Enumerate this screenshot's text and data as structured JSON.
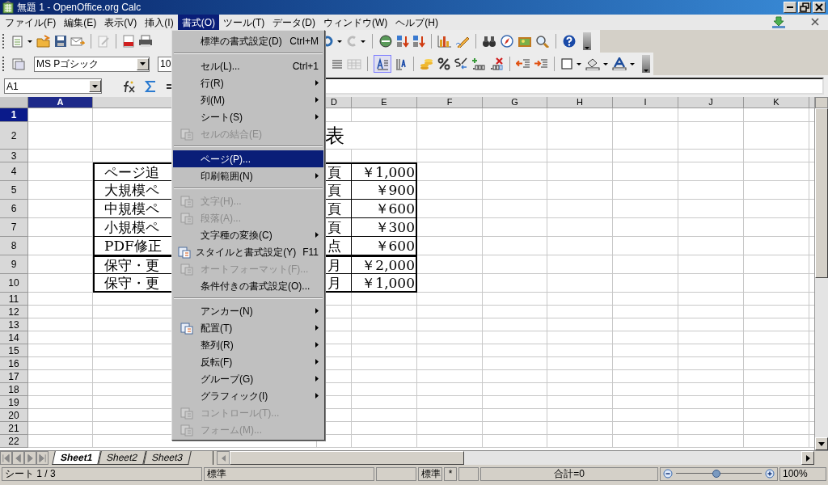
{
  "window": {
    "title": "無題 1 - OpenOffice.org Calc"
  },
  "menu_bar": [
    {
      "label": "ファイル(F)",
      "selected": false
    },
    {
      "label": "編集(E)",
      "selected": false
    },
    {
      "label": "表示(V)",
      "selected": false
    },
    {
      "label": "挿入(I)",
      "selected": false
    },
    {
      "label": "書式(O)",
      "selected": true
    },
    {
      "label": "ツール(T)",
      "selected": false
    },
    {
      "label": "データ(D)",
      "selected": false
    },
    {
      "label": "ウィンドウ(W)",
      "selected": false
    },
    {
      "label": "ヘルプ(H)",
      "selected": false
    }
  ],
  "formatting_toolbar": {
    "font_name": "MS Pゴシック",
    "font_size": "10"
  },
  "formula_bar": {
    "name_box": "A1"
  },
  "sheet": {
    "columns": [
      {
        "label": "A",
        "selected": true
      },
      {
        "label": "D",
        "selected": false
      },
      {
        "label": "E",
        "selected": false
      },
      {
        "label": "F",
        "selected": false
      },
      {
        "label": "G",
        "selected": false
      },
      {
        "label": "H",
        "selected": false
      },
      {
        "label": "I",
        "selected": false
      },
      {
        "label": "J",
        "selected": false
      },
      {
        "label": "K",
        "selected": false
      }
    ],
    "rows": [
      {
        "label": "1",
        "selected": true
      },
      {
        "label": "2",
        "selected": false,
        "title_fragment": "表"
      },
      {
        "label": "3",
        "selected": false
      },
      {
        "label": "4",
        "selected": false,
        "cells": [
          "ページ追",
          "頁",
          "￥1,000"
        ]
      },
      {
        "label": "5",
        "selected": false,
        "cells": [
          "大規模ペ",
          "頁",
          "￥900"
        ]
      },
      {
        "label": "6",
        "selected": false,
        "cells": [
          "中規模ペ",
          "頁",
          "￥600"
        ]
      },
      {
        "label": "7",
        "selected": false,
        "cells": [
          "小規模ペ",
          "頁",
          "￥300"
        ]
      },
      {
        "label": "8",
        "selected": false,
        "cells": [
          "PDF修正",
          "点",
          "￥600"
        ]
      },
      {
        "label": "9",
        "selected": false,
        "cells": [
          "保守・更",
          "月",
          "￥2,000"
        ]
      },
      {
        "label": "10",
        "selected": false,
        "cells": [
          "保守・更",
          "月",
          "￥1,000"
        ]
      },
      {
        "label": "11",
        "selected": false
      },
      {
        "label": "12",
        "selected": false
      },
      {
        "label": "13",
        "selected": false
      },
      {
        "label": "14",
        "selected": false
      },
      {
        "label": "15",
        "selected": false
      },
      {
        "label": "16",
        "selected": false
      },
      {
        "label": "17",
        "selected": false
      },
      {
        "label": "18",
        "selected": false
      },
      {
        "label": "19",
        "selected": false
      },
      {
        "label": "20",
        "selected": false
      },
      {
        "label": "21",
        "selected": false
      },
      {
        "label": "22",
        "selected": false
      }
    ]
  },
  "sheet_tabs": [
    {
      "label": "Sheet1",
      "selected": true
    },
    {
      "label": "Sheet2",
      "selected": false
    },
    {
      "label": "Sheet3",
      "selected": false
    }
  ],
  "format_menu": [
    {
      "kind": "item",
      "label": "標準の書式設定(D)",
      "shortcut": "Ctrl+M",
      "submenu": false,
      "disabled": false,
      "selected": false
    },
    {
      "kind": "separator"
    },
    {
      "kind": "item",
      "label": "セル(L)...",
      "shortcut": "Ctrl+1",
      "submenu": false,
      "disabled": false,
      "selected": false
    },
    {
      "kind": "item",
      "label": "行(R)",
      "submenu": true,
      "disabled": false,
      "selected": false
    },
    {
      "kind": "item",
      "label": "列(M)",
      "submenu": true,
      "disabled": false,
      "selected": false
    },
    {
      "kind": "item",
      "label": "シート(S)",
      "submenu": true,
      "disabled": false,
      "selected": false
    },
    {
      "kind": "icon_item",
      "label": "セルの結合(E)",
      "submenu": false,
      "disabled": true,
      "selected": false
    },
    {
      "kind": "separator"
    },
    {
      "kind": "item",
      "label": "ページ(P)...",
      "submenu": false,
      "disabled": false,
      "selected": true
    },
    {
      "kind": "item",
      "label": "印刷範囲(N)",
      "submenu": true,
      "disabled": false,
      "selected": false
    },
    {
      "kind": "separator"
    },
    {
      "kind": "icon_item",
      "label": "文字(H)...",
      "submenu": false,
      "disabled": true,
      "selected": false
    },
    {
      "kind": "icon_item",
      "label": "段落(A)...",
      "submenu": false,
      "disabled": true,
      "selected": false
    },
    {
      "kind": "item",
      "label": "文字種の変換(C)",
      "submenu": true,
      "disabled": false,
      "selected": false
    },
    {
      "kind": "icon_item",
      "label": "スタイルと書式設定(Y)",
      "shortcut": "F11",
      "submenu": false,
      "disabled": false,
      "selected": false
    },
    {
      "kind": "icon_item",
      "label": "オートフォーマット(F)...",
      "submenu": false,
      "disabled": true,
      "selected": false
    },
    {
      "kind": "item",
      "label": "条件付きの書式設定(O)...",
      "submenu": false,
      "disabled": false,
      "selected": false
    },
    {
      "kind": "separator"
    },
    {
      "kind": "item",
      "label": "アンカー(N)",
      "submenu": true,
      "disabled": false,
      "selected": false
    },
    {
      "kind": "icon_item",
      "label": "配置(T)",
      "submenu": true,
      "disabled": false,
      "selected": false
    },
    {
      "kind": "item",
      "label": "整列(R)",
      "submenu": true,
      "disabled": false,
      "selected": false
    },
    {
      "kind": "item",
      "label": "反転(F)",
      "submenu": true,
      "disabled": false,
      "selected": false
    },
    {
      "kind": "item",
      "label": "グループ(G)",
      "submenu": true,
      "disabled": false,
      "selected": false
    },
    {
      "kind": "item",
      "label": "グラフィック(I)",
      "submenu": true,
      "disabled": false,
      "selected": false
    },
    {
      "kind": "icon_item",
      "label": "コントロール(T)...",
      "submenu": false,
      "disabled": true,
      "selected": false
    },
    {
      "kind": "icon_item",
      "label": "フォーム(M)...",
      "submenu": false,
      "disabled": true,
      "selected": false
    }
  ],
  "status_bar": {
    "sheet": "シート 1 / 3",
    "page_style": "標準",
    "mode": "標準",
    "modified": "*",
    "sum": "合計=0",
    "level": 0.47,
    "zoom": "100%"
  }
}
